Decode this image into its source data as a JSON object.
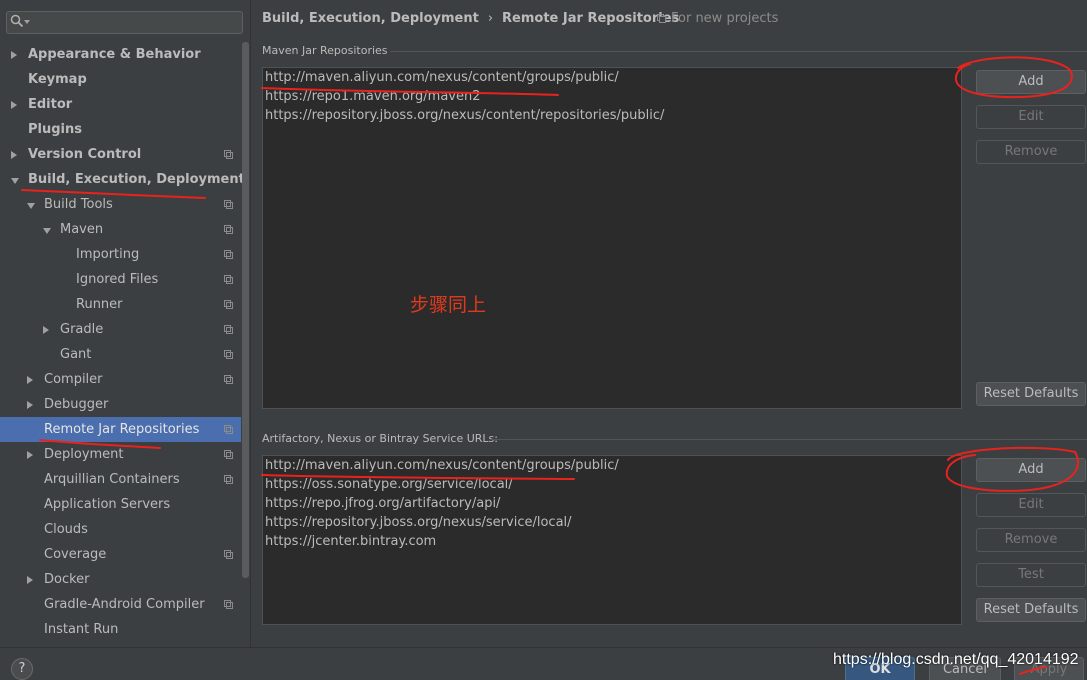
{
  "search": {
    "value": "",
    "placeholder": ""
  },
  "tree": [
    {
      "label": "Appearance & Behavior",
      "bold": true,
      "twisty": "right",
      "copy": false
    },
    {
      "label": "Keymap",
      "bold": true,
      "twisty": "",
      "copy": false
    },
    {
      "label": "Editor",
      "bold": true,
      "twisty": "right",
      "copy": false
    },
    {
      "label": "Plugins",
      "bold": true,
      "twisty": "",
      "copy": false
    },
    {
      "label": "Version Control",
      "bold": true,
      "twisty": "right",
      "copy": true
    },
    {
      "label": "Build, Execution, Deployment",
      "bold": true,
      "twisty": "down",
      "copy": false
    },
    {
      "label": "Build Tools",
      "bold": false,
      "twisty": "down",
      "copy": true
    },
    {
      "label": "Maven",
      "bold": false,
      "twisty": "down",
      "copy": true
    },
    {
      "label": "Importing",
      "bold": false,
      "twisty": "",
      "copy": true
    },
    {
      "label": "Ignored Files",
      "bold": false,
      "twisty": "",
      "copy": true
    },
    {
      "label": "Runner",
      "bold": false,
      "twisty": "",
      "copy": true
    },
    {
      "label": "Gradle",
      "bold": false,
      "twisty": "right",
      "copy": true
    },
    {
      "label": "Gant",
      "bold": false,
      "twisty": "",
      "copy": true
    },
    {
      "label": "Compiler",
      "bold": false,
      "twisty": "right",
      "copy": true
    },
    {
      "label": "Debugger",
      "bold": false,
      "twisty": "right",
      "copy": false
    },
    {
      "label": "Remote Jar Repositories",
      "bold": false,
      "twisty": "",
      "copy": true,
      "selected": true
    },
    {
      "label": "Deployment",
      "bold": false,
      "twisty": "right",
      "copy": true
    },
    {
      "label": "Arquillian Containers",
      "bold": false,
      "twisty": "",
      "copy": true
    },
    {
      "label": "Application Servers",
      "bold": false,
      "twisty": "",
      "copy": false
    },
    {
      "label": "Clouds",
      "bold": false,
      "twisty": "",
      "copy": false
    },
    {
      "label": "Coverage",
      "bold": false,
      "twisty": "",
      "copy": true
    },
    {
      "label": "Docker",
      "bold": false,
      "twisty": "right",
      "copy": false
    },
    {
      "label": "Gradle-Android Compiler",
      "bold": false,
      "twisty": "",
      "copy": true
    },
    {
      "label": "Instant Run",
      "bold": false,
      "twisty": "",
      "copy": false
    }
  ],
  "breadcrumb": {
    "parent": "Build, Execution, Deployment",
    "separator": "›",
    "current": "Remote Jar Repositories"
  },
  "for_new_projects": "For new projects",
  "maven": {
    "header": "Maven Jar Repositories",
    "items": [
      "http://maven.aliyun.com/nexus/content/groups/public/",
      "https://repo1.maven.org/maven2",
      "https://repository.jboss.org/nexus/content/repositories/public/"
    ],
    "buttons": {
      "add": "Add",
      "edit": "Edit",
      "remove": "Remove",
      "reset": "Reset Defaults"
    }
  },
  "artifactory": {
    "header": "Artifactory, Nexus or Bintray Service URLs:",
    "items": [
      "http://maven.aliyun.com/nexus/content/groups/public/",
      "https://oss.sonatype.org/service/local/",
      "https://repo.jfrog.org/artifactory/api/",
      "https://repository.jboss.org/nexus/service/local/",
      "https://jcenter.bintray.com"
    ],
    "buttons": {
      "add": "Add",
      "edit": "Edit",
      "remove": "Remove",
      "test": "Test",
      "reset": "Reset Defaults"
    }
  },
  "annotation_text": "步骤同上",
  "footer": {
    "help": "?",
    "ok": "OK",
    "cancel": "Cancel",
    "apply": "Apply"
  },
  "watermark": "https://blog.csdn.net/qq_42014192",
  "colors": {
    "accent_selection": "#4b6eaf",
    "annotation_red": "#e03a1e",
    "background": "#3c3f41",
    "list_background": "#2b2b2b"
  }
}
